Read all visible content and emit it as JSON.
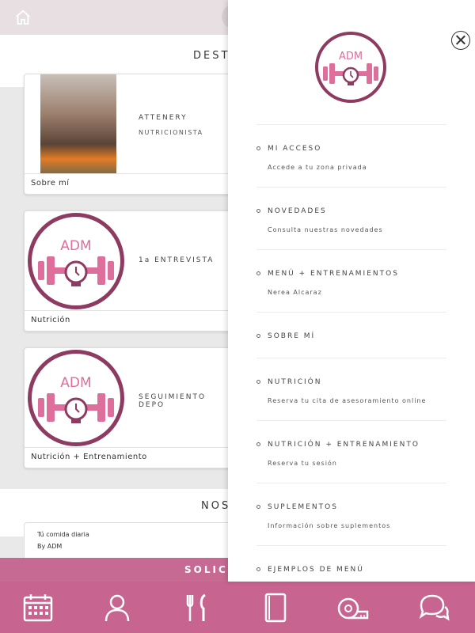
{
  "header": {
    "section_title": "DESTA"
  },
  "cards": [
    {
      "name": "ATTENERY",
      "role": "NUTRICIONISTA",
      "footer": "Sobre mí"
    },
    {
      "name": "1a ENTREVISTA",
      "footer": "Nutrición"
    },
    {
      "name": "SEGUIMIENTO DEPO",
      "footer": "Nutrición + Entrenamiento"
    }
  ],
  "logo": {
    "text": "ADM"
  },
  "section2": {
    "title": "NOS"
  },
  "food_card": {
    "title": "Tú comida diaria",
    "author": "By ADM"
  },
  "cta": {
    "label": "SOLICI"
  },
  "drawer": {
    "items": [
      {
        "label": "MI ACCESO",
        "sub": "Accede a tu zona privada"
      },
      {
        "label": "NOVEDADES",
        "sub": "Consulta nuestras novedades"
      },
      {
        "label": "MENÚ + ENTRENAMIENTOS",
        "sub": "Nerea Alcaraz"
      },
      {
        "label": "SOBRE MÍ",
        "sub": ""
      },
      {
        "label": "NUTRICIÓN",
        "sub": "Reserva tu cita de asesoramiento online"
      },
      {
        "label": "NUTRICIÓN + ENTRENAMIENTO",
        "sub": "Reserva tu sesión"
      },
      {
        "label": "SUPLEMENTOS",
        "sub": "Información sobre suplementos"
      },
      {
        "label": "EJEMPLOS DE MENÚ",
        "sub": ""
      }
    ]
  },
  "bottom_nav": {
    "icons": [
      "calendar-icon",
      "user-icon",
      "cutlery-icon",
      "book-icon",
      "tape-measure-icon",
      "chat-icon"
    ]
  },
  "colors": {
    "brand": "#8e3b62",
    "accent": "#c7648f",
    "logo_pink": "#de6f9c"
  }
}
